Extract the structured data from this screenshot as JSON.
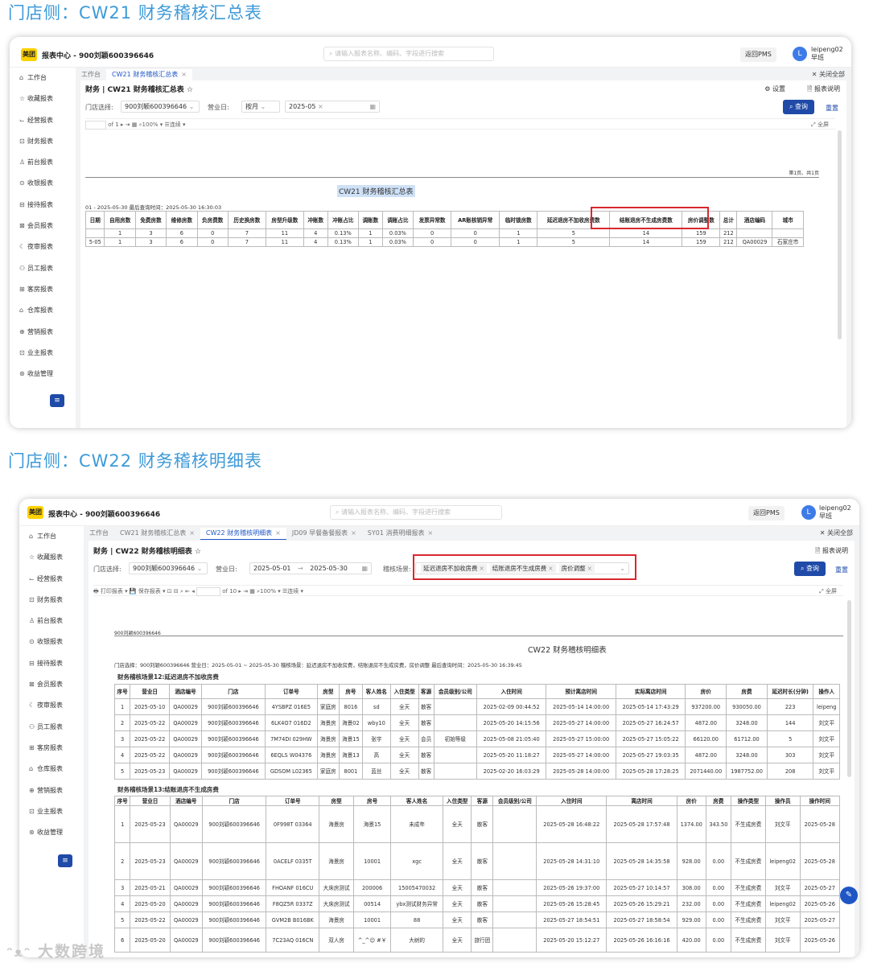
{
  "section1_title": "门店侧：CW21 财务稽核汇总表",
  "section2_title": "门店侧：CW22 财务稽核明细表",
  "app": {
    "logo": "美团",
    "title": "报表中心 - 900刘颖600396646",
    "search_placeholder": "请输入报表名称、编码、字段进行搜索",
    "back_pms": "返回PMS",
    "avatar_letter": "L",
    "username": "leipeng02",
    "shift": "早班"
  },
  "sidebar": [
    "工作台",
    "收藏报表",
    "经营报表",
    "财务报表",
    "前台报表",
    "收银报表",
    "接待报表",
    "会员报表",
    "夜审报表",
    "员工报表",
    "客房报表",
    "仓库报表",
    "营销报表",
    "业主报表",
    "收益管理"
  ],
  "sidebar_icons": [
    "⌂",
    "☆",
    "⌙",
    "⊡",
    "♙",
    "⊙",
    "⊟",
    "⊠",
    "☾",
    "⚇",
    "⊞",
    "⌂",
    "⊕",
    "⊡",
    "⊛"
  ],
  "fold_icon": "≡",
  "w1": {
    "tabs": [
      "工作台",
      "CW21 财务稽核汇总表"
    ],
    "close_all": "关闭全部",
    "page_title": "财务 | CW21 财务稽核汇总表 ☆",
    "settings": "设置",
    "report_desc": "报表说明",
    "store_label": "门店选择:",
    "store_value": "900刘颖600396646",
    "bizday_label": "营业日:",
    "bizday_mode": "按月",
    "bizday_value": "2025-05",
    "query": "查询",
    "reset": "重置",
    "toolbar_of": "of 1",
    "zoom": "100%",
    "continuous": "连续",
    "fullscreen": "全屏",
    "page_info": "第1页、共1页",
    "report_title": "CW21 财务稽核汇总表",
    "meta": "01 - 2025-05-30    最后查询时间：2025-05-30 16:30:03",
    "headers": [
      "日期",
      "自用房数",
      "免费房数",
      "维修房数",
      "负房费数",
      "历史换房数",
      "房型升级数",
      "冲账数",
      "冲账占比",
      "调账数",
      "调账占比",
      "发票异常数",
      "AR账核销异常",
      "临时锁房数",
      "延迟退房不加收房费数",
      "结账退房不生成房费数",
      "房价调整数",
      "总计",
      "酒店编码",
      "城市"
    ],
    "total_row": [
      "",
      "1",
      "3",
      "6",
      "0",
      "7",
      "11",
      "4",
      "0.13%",
      "1",
      "0.03%",
      "0",
      "0",
      "1",
      "5",
      "14",
      "159",
      "212",
      "",
      ""
    ],
    "data_row": [
      "5-05",
      "1",
      "3",
      "6",
      "0",
      "7",
      "11",
      "4",
      "0.13%",
      "1",
      "0.03%",
      "0",
      "0",
      "1",
      "5",
      "14",
      "159",
      "212",
      "QA00029",
      "石家庄市"
    ]
  },
  "w2": {
    "tabs": [
      "工作台",
      "CW21 财务稽核汇总表",
      "CW22 财务稽核明细表",
      "JD09 早餐备餐报表",
      "SY01 消费明细报表"
    ],
    "close_all": "关闭全部",
    "page_title": "财务 | CW22 财务稽核明细表 ☆",
    "report_desc": "报表说明",
    "store_label": "门店选择:",
    "store_value": "900刘颖600396646",
    "bizday_label": "营业日:",
    "date_from": "2025-05-01",
    "date_to": "2025-05-30",
    "scene_label": "稽核场景:",
    "scene_tags": [
      "延迟退房不加收房费",
      "结账退房不生成房费",
      "房价调整"
    ],
    "query": "查询",
    "reset": "重置",
    "print": "打印报表",
    "save": "保存报表",
    "toolbar_of": "of 10",
    "zoom": "100%",
    "continuous": "连续",
    "fullscreen": "全屏",
    "store_top": "900刘颖600396646",
    "report_title": "CW22 财务稽核明细表",
    "meta": "门店选择：900刘颖600396646    营业日：2025-05-01 ~ 2025-05-30    稽核场景：延迟退房不加收房费，结账退房不生成房费，房价调整    最后查询时间：2025-05-30 16:39:45",
    "scene12_title": "财务稽核场景12:延迟退房不加收房费",
    "scene12_headers": [
      "序号",
      "营业日",
      "酒店编号",
      "门店",
      "订单号",
      "房型",
      "房号",
      "客人姓名",
      "入住类型",
      "客源",
      "会员级别/公司",
      "入住时间",
      "预计离店时间",
      "实际离店时间",
      "房价",
      "房费",
      "延迟时长(分钟)",
      "操作人"
    ],
    "scene12_rows": [
      [
        "1",
        "2025-05-10",
        "QA00029",
        "900刘颖600396646",
        "4YSBPZ 016E5",
        "家庭房",
        "8016",
        "sd",
        "全天",
        "散客",
        "",
        "2025-02-09 00:44:52",
        "2025-05-14 14:00:00",
        "2025-05-14 17:43:29",
        "937200.00",
        "930050.00",
        "223",
        "leipeng"
      ],
      [
        "2",
        "2025-05-22",
        "QA00029",
        "900刘颖600396646",
        "6LK4O7 016D2",
        "海景房",
        "海景02",
        "wby10",
        "全天",
        "散客",
        "",
        "2025-05-20 14:15:56",
        "2025-05-27 14:00:00",
        "2025-05-27 16:24:57",
        "4872.00",
        "3248.00",
        "144",
        "刘文平"
      ],
      [
        "3",
        "2025-05-22",
        "QA00029",
        "900刘颖600396646",
        "7M74DI 029HW",
        "海景房",
        "海景15",
        "张宇",
        "全天",
        "会员",
        "初始等级",
        "2025-05-08 21:05:40",
        "2025-05-27 15:00:00",
        "2025-05-27 15:05:22",
        "66120.00",
        "61712.00",
        "5",
        "刘文平"
      ],
      [
        "4",
        "2025-05-22",
        "QA00029",
        "900刘颖600396646",
        "6EQLS W04376",
        "海景房",
        "海景13",
        "高",
        "全天",
        "散客",
        "",
        "2025-05-20 11:18:27",
        "2025-05-27 14:00:00",
        "2025-05-27 19:03:35",
        "4872.00",
        "3248.00",
        "303",
        "刘文平"
      ],
      [
        "5",
        "2025-05-23",
        "QA00029",
        "900刘颖600396646",
        "GDSOM L02365",
        "家庭房",
        "8001",
        "蓝丝",
        "全天",
        "散客",
        "",
        "2025-02-20 16:03:29",
        "2025-05-28 14:00:00",
        "2025-05-28 17:28:25",
        "2071440.00",
        "1987752.00",
        "208",
        "刘文平"
      ]
    ],
    "scene13_title": "财务稽核场景13:结账退房不生成房费",
    "scene13_headers": [
      "序号",
      "营业日",
      "酒店编号",
      "门店",
      "订单号",
      "房型",
      "房号",
      "客人姓名",
      "入住类型",
      "客源",
      "会员级别/公司",
      "入住时间",
      "离店时间",
      "房价",
      "房费",
      "操作类型",
      "操作员",
      "操作时间"
    ],
    "scene13_rows": [
      [
        "1",
        "2025-05-23",
        "QA00029",
        "900刘颖600396646",
        "0F998T 03364",
        "海景房",
        "海景15",
        "未成年",
        "全天",
        "散客",
        "",
        "2025-05-28 16:48:22",
        "2025-05-28 17:57:48",
        "1374.00",
        "343.50",
        "不生成房费",
        "刘文平",
        "2025-05-28"
      ],
      [
        "2",
        "2025-05-23",
        "QA00029",
        "900刘颖600396646",
        "0ACELF 0335T",
        "海景房",
        "10001",
        "xgc",
        "全天",
        "散客",
        "",
        "2025-05-28 14:31:10",
        "2025-05-28 14:35:58",
        "928.00",
        "0.00",
        "不生成房费",
        "leipeng02",
        "2025-05-28"
      ],
      [
        "3",
        "2025-05-21",
        "QA00029",
        "900刘颖600396646",
        "FHOANF 016CU",
        "大床房测试",
        "200006",
        "15005470032",
        "全天",
        "散客",
        "",
        "2025-05-26 19:37:00",
        "2025-05-27 10:14:57",
        "308.00",
        "0.00",
        "不生成房费",
        "刘文平",
        "2025-05-27"
      ],
      [
        "4",
        "2025-05-20",
        "QA00029",
        "900刘颖600396646",
        "F8QZ5R 0337Z",
        "大床房测试",
        "00514",
        "ybx测试财务异常",
        "全天",
        "散客",
        "",
        "2025-05-26 15:28:45",
        "2025-05-26 15:29:21",
        "232.00",
        "0.00",
        "不生成房费",
        "leipeng02",
        "2025-05-26"
      ],
      [
        "5",
        "2025-05-22",
        "QA00029",
        "900刘颖600396646",
        "GVM2B B016BK",
        "海景房",
        "10001",
        "88",
        "全天",
        "散客",
        "",
        "2025-05-27 18:54:51",
        "2025-05-27 18:58:54",
        "929.00",
        "0.00",
        "不生成房费",
        "刘文平",
        "2025-05-27"
      ],
      [
        "6",
        "2025-05-20",
        "QA00029",
        "900刘颖600396646",
        "7C23AQ 016CN",
        "双人房",
        "^_^😊 #￥",
        "大树的",
        "全天",
        "旅行团",
        "",
        "2025-05-20 15:12:27",
        "2025-05-26 16:16:16",
        "420.00",
        "0.00",
        "不生成房费",
        "刘文平",
        "2025-05-26"
      ]
    ]
  },
  "watermark": "大数跨境"
}
